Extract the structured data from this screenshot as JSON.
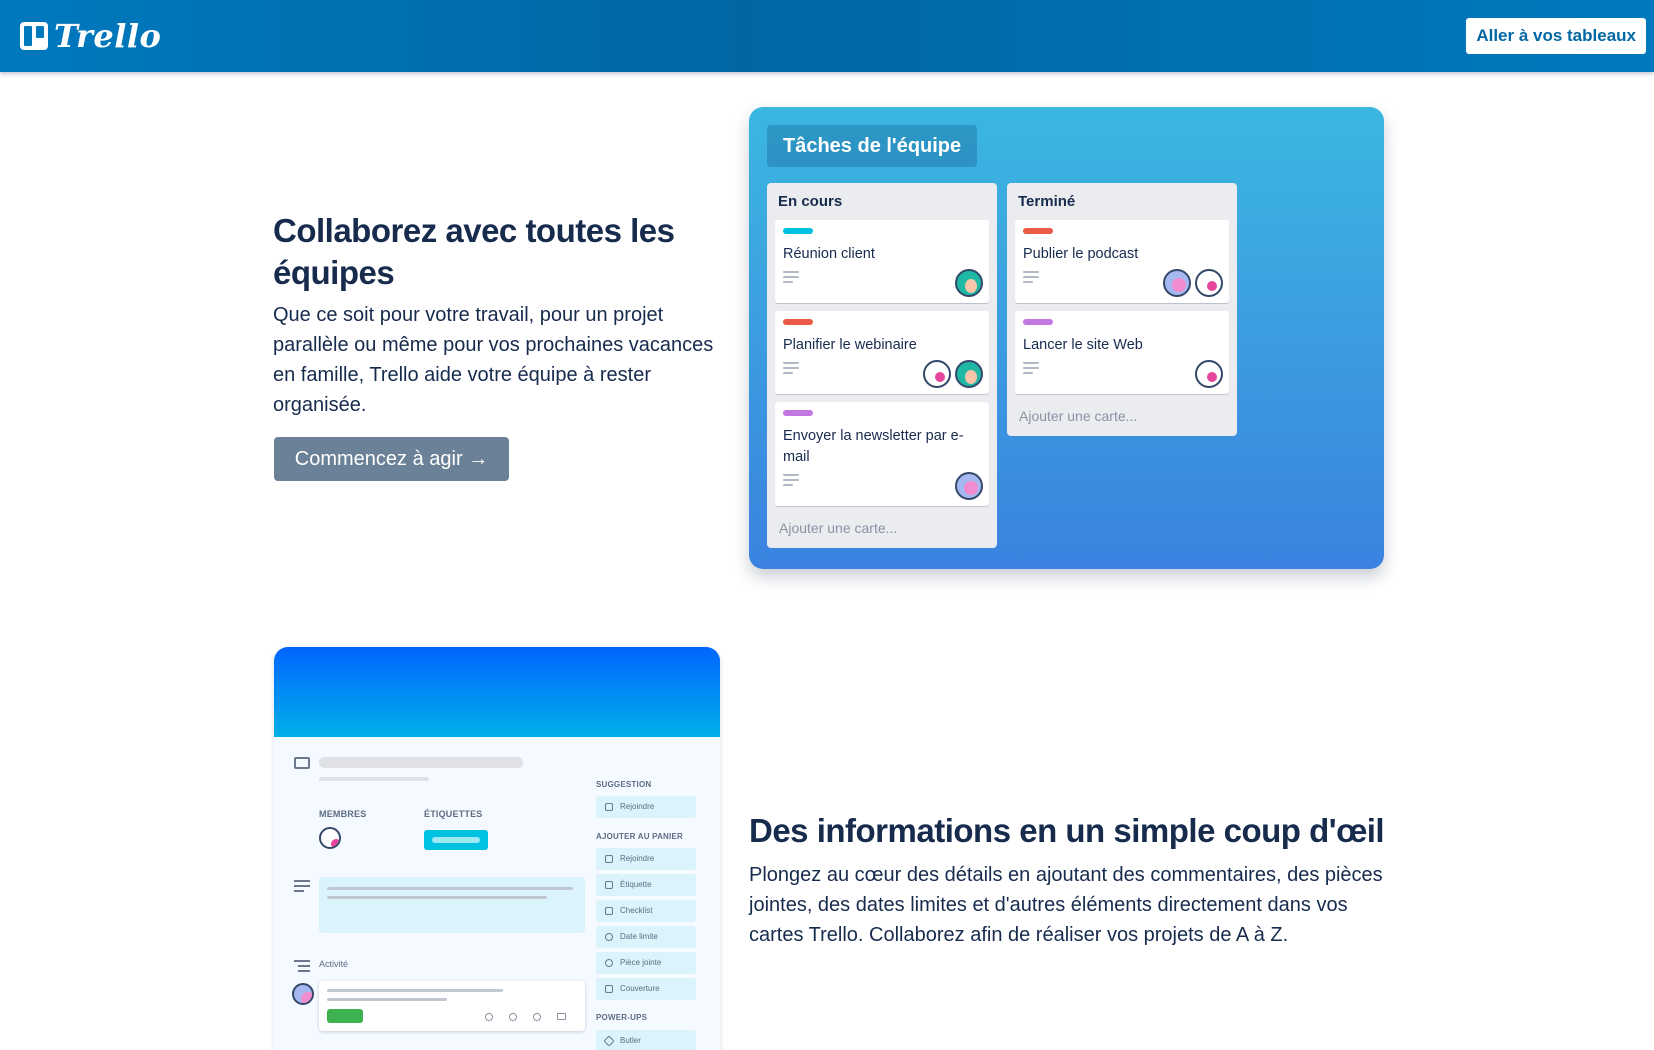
{
  "header": {
    "logo_text": "Trello",
    "boards_button": "Aller à vos tableaux",
    "background": "#0079bf"
  },
  "section1": {
    "title": "Collaborez avec toutes les équipes",
    "description": "Que ce soit pour votre travail, pour un projet parallèle ou même pour vos prochaines vacances en famille, Trello aide votre équipe à rester organisée.",
    "cta": "Commencez à agir →"
  },
  "board": {
    "title": "Tâches de l'équipe",
    "lists": [
      {
        "title": "En cours",
        "cards": [
          {
            "title": "Réunion client",
            "label_color": "#00c2e0",
            "avatars": [
              "teal"
            ]
          },
          {
            "title": "Planifier le webinaire",
            "label_color": "#eb5a46",
            "avatars": [
              "white",
              "teal"
            ]
          },
          {
            "title": "Envoyer la newsletter par e-mail",
            "label_color": "#c377e0",
            "avatars": [
              "pink"
            ]
          }
        ],
        "add_card": "Ajouter une carte..."
      },
      {
        "title": "Terminé",
        "cards": [
          {
            "title": "Publier le podcast",
            "label_color": "#eb5a46",
            "avatars": [
              "pink",
              "white"
            ]
          },
          {
            "title": "Lancer le site Web",
            "label_color": "#c377e0",
            "avatars": [
              "white"
            ]
          }
        ],
        "add_card": "Ajouter une carte..."
      }
    ]
  },
  "card_detail": {
    "members_label": "MEMBRES",
    "labels_label": "ÉTIQUETTES",
    "activity_label": "Activité",
    "suggestion_label": "SUGGESTION",
    "suggestion_items": [
      "Rejoindre"
    ],
    "add_to_card_label": "AJOUTER AU PANIER",
    "add_to_card_items": [
      "Rejoindre",
      "Étiquette",
      "Checklist",
      "Date limite",
      "Pièce jointe",
      "Couverture"
    ],
    "powerups_label": "POWER-UPS",
    "powerups_items": [
      "Butler"
    ]
  },
  "section2": {
    "title": "Des informations en un simple coup d'œil",
    "description": "Plongez au cœur des détails en ajoutant des commentaires, des pièces jointes, des dates limites et d'autres éléments directement dans vos cartes Trello. Collaborez afin de réaliser vos projets de A à Z."
  }
}
